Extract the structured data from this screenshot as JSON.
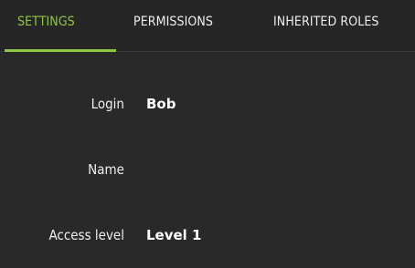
{
  "tabs": [
    {
      "label": "SETTINGS",
      "active": true
    },
    {
      "label": "PERMISSIONS",
      "active": false
    },
    {
      "label": "INHERITED ROLES",
      "active": false
    }
  ],
  "fields": [
    {
      "label": "Login",
      "value": "Bob"
    },
    {
      "label": "Name",
      "value": ""
    },
    {
      "label": "Access level",
      "value": "Level 1"
    }
  ],
  "colors": {
    "background": "#292929",
    "accent": "#8fc742",
    "text": "#efefef"
  }
}
